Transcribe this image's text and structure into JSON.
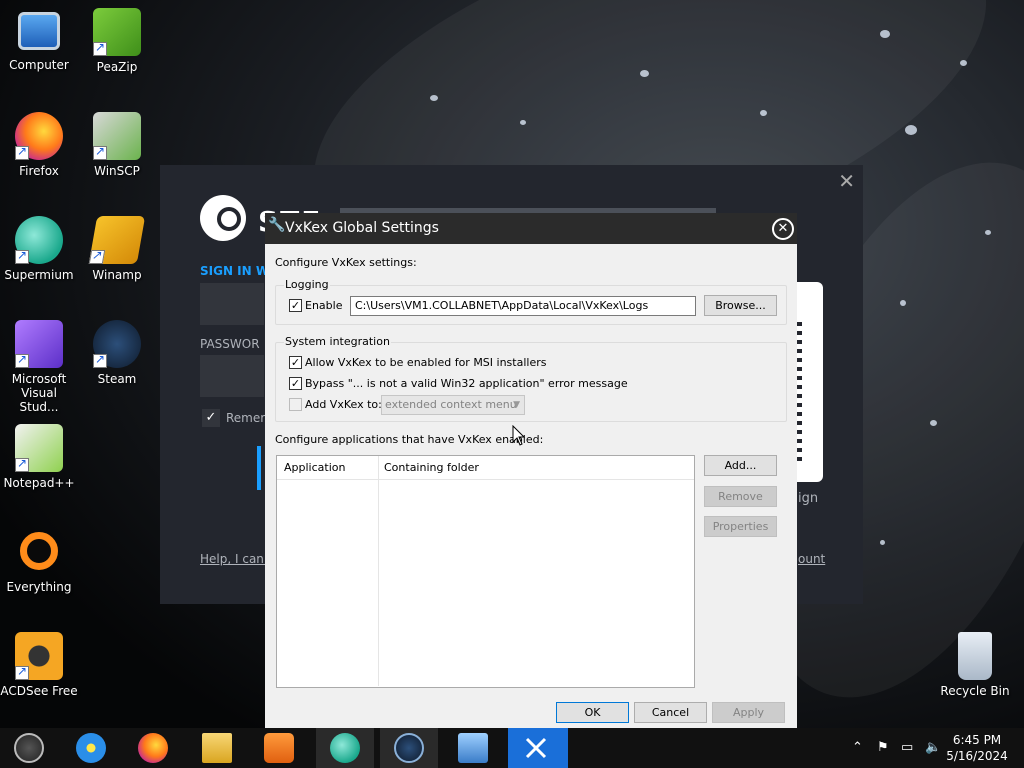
{
  "colors": {
    "steam_accent": "#1a9fff",
    "taskbar_active": "#1a6fd9",
    "dialog_bg": "#f0f0f0",
    "titlebar": "#2b2b2b"
  },
  "desktop": {
    "icons": [
      {
        "label": "Computer",
        "icon": "computer-icon"
      },
      {
        "label": "PeaZip",
        "icon": "peazip-icon"
      },
      {
        "label": "Firefox",
        "icon": "firefox-icon"
      },
      {
        "label": "WinSCP",
        "icon": "winscp-icon"
      },
      {
        "label": "Supermium",
        "icon": "supermium-icon"
      },
      {
        "label": "Winamp",
        "icon": "winamp-icon"
      },
      {
        "label": "Microsoft Visual Stud...",
        "icon": "visual-studio-icon"
      },
      {
        "label": "Steam",
        "icon": "steam-icon"
      },
      {
        "label": "Notepad++",
        "icon": "notepadpp-icon"
      },
      {
        "label": "Everything",
        "icon": "everything-icon"
      },
      {
        "label": "ACDSee Free",
        "icon": "acdsee-icon"
      },
      {
        "label": "Recycle Bin",
        "icon": "recycle-bin-icon"
      }
    ]
  },
  "steam": {
    "title": "STE",
    "sign_in": "SIGN IN W",
    "password": "PASSWOR",
    "remember": "Remer",
    "help": "Help, I can'",
    "sign": "ign",
    "account": "ount"
  },
  "vxkex": {
    "title": "VxKex Global Settings",
    "configure_label": "Configure VxKex settings:",
    "logging": {
      "group": "Logging",
      "enable_label": "Enable",
      "enable_checked": true,
      "path": "C:\\Users\\VM1.COLLABNET\\AppData\\Local\\VxKex\\Logs",
      "browse": "Browse..."
    },
    "system": {
      "group": "System integration",
      "msi_label": "Allow VxKex to be enabled for MSI installers",
      "msi_checked": true,
      "bypass_label": "Bypass \"... is not a valid Win32 application\" error message",
      "bypass_checked": true,
      "add_label": "Add VxKex to:",
      "add_checked": false,
      "add_option": "extended context menu"
    },
    "apps": {
      "label": "Configure applications that have VxKex enabled:",
      "columns": [
        "Application",
        "Containing folder"
      ],
      "add": "Add...",
      "remove": "Remove",
      "properties": "Properties"
    },
    "buttons": {
      "ok": "OK",
      "cancel": "Cancel",
      "apply": "Apply"
    }
  },
  "taskbar": {
    "apps": [
      "windows-start-icon",
      "internet-explorer-icon",
      "firefox-icon",
      "file-explorer-icon",
      "media-player-icon",
      "supermium-icon",
      "steam-icon",
      "control-panel-icon",
      "vxkex-tools-icon"
    ],
    "time": "6:45 PM",
    "date": "5/16/2024"
  }
}
